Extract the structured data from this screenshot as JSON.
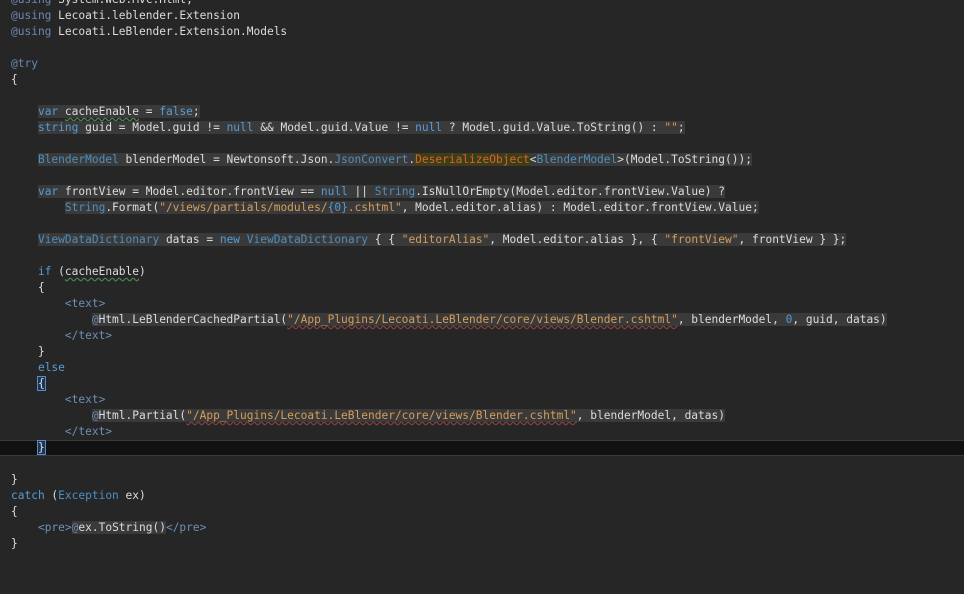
{
  "editor": {
    "lines": [
      {
        "n": 0,
        "segments": [
          {
            "t": "@using",
            "c": "at"
          },
          {
            "t": " System.Web.Mvc.Html;",
            "c": ""
          }
        ]
      },
      {
        "n": 1,
        "segments": [
          {
            "t": "@using",
            "c": "at"
          },
          {
            "t": " Lecoati.leblender.Extension",
            "c": ""
          }
        ]
      },
      {
        "n": 2,
        "segments": [
          {
            "t": "@using",
            "c": "at"
          },
          {
            "t": " Lecoati.LeBlender.Extension.Models",
            "c": ""
          }
        ]
      },
      {
        "n": 3,
        "segments": []
      },
      {
        "n": 4,
        "segments": [
          {
            "t": "@try",
            "c": "at"
          }
        ]
      },
      {
        "n": 5,
        "segments": [
          {
            "t": "{",
            "c": ""
          }
        ]
      },
      {
        "n": 6,
        "segments": []
      },
      {
        "n": 7,
        "segments": [
          {
            "t": "    ",
            "c": ""
          },
          {
            "t": "var",
            "c": "kw hl"
          },
          {
            "t": " ",
            "c": "hl"
          },
          {
            "t": "cacheEnable",
            "c": "hl ul"
          },
          {
            "t": " = ",
            "c": "hl"
          },
          {
            "t": "false",
            "c": "kw hl"
          },
          {
            "t": ";",
            "c": "hl"
          }
        ]
      },
      {
        "n": 8,
        "segments": [
          {
            "t": "    ",
            "c": ""
          },
          {
            "t": "string",
            "c": "kw hl"
          },
          {
            "t": " guid = Model.guid != ",
            "c": "hl"
          },
          {
            "t": "null",
            "c": "kw hl"
          },
          {
            "t": " && Model.guid.Value != ",
            "c": "hl"
          },
          {
            "t": "null",
            "c": "kw hl"
          },
          {
            "t": " ? Model.guid.Value.ToString() : ",
            "c": "hl"
          },
          {
            "t": "\"\"",
            "c": "st hl"
          },
          {
            "t": ";",
            "c": "hl"
          }
        ]
      },
      {
        "n": 9,
        "segments": []
      },
      {
        "n": 10,
        "segments": [
          {
            "t": "    ",
            "c": ""
          },
          {
            "t": "BlenderModel",
            "c": "ty hl"
          },
          {
            "t": " blenderModel = Newtonsoft.Json.",
            "c": "hl"
          },
          {
            "t": "JsonConvert",
            "c": "ty hl"
          },
          {
            "t": ".",
            "c": "hl"
          },
          {
            "t": "DeserializeObject",
            "c": "err"
          },
          {
            "t": "<",
            "c": "hl"
          },
          {
            "t": "BlenderModel",
            "c": "ty hl"
          },
          {
            "t": ">(Model.ToString());",
            "c": "hl"
          }
        ]
      },
      {
        "n": 11,
        "segments": []
      },
      {
        "n": 12,
        "segments": [
          {
            "t": "    ",
            "c": ""
          },
          {
            "t": "var",
            "c": "kw hl"
          },
          {
            "t": " frontView = Model.editor.frontView == ",
            "c": "hl"
          },
          {
            "t": "null",
            "c": "kw hl"
          },
          {
            "t": " || ",
            "c": "hl"
          },
          {
            "t": "String",
            "c": "ty hl"
          },
          {
            "t": ".IsNullOrEmpty(Model.editor.frontView.Value) ?",
            "c": "hl"
          }
        ]
      },
      {
        "n": 13,
        "segments": [
          {
            "t": "        ",
            "c": ""
          },
          {
            "t": "String",
            "c": "ty hl"
          },
          {
            "t": ".Format(",
            "c": "hl"
          },
          {
            "t": "\"/views/partials/modules/",
            "c": "st hl"
          },
          {
            "t": "{0}",
            "c": "kw hl"
          },
          {
            "t": ".cshtml\"",
            "c": "st hl"
          },
          {
            "t": ", Model.editor.alias) : Model.editor.frontView.Value;",
            "c": "hl"
          }
        ]
      },
      {
        "n": 14,
        "segments": []
      },
      {
        "n": 15,
        "segments": [
          {
            "t": "    ",
            "c": ""
          },
          {
            "t": "ViewDataDictionary",
            "c": "ty hl"
          },
          {
            "t": " datas = ",
            "c": "hl"
          },
          {
            "t": "new",
            "c": "kw hl"
          },
          {
            "t": " ",
            "c": "hl"
          },
          {
            "t": "ViewDataDictionary",
            "c": "ty hl"
          },
          {
            "t": " { { ",
            "c": "hl"
          },
          {
            "t": "\"editorAlias\"",
            "c": "st hl"
          },
          {
            "t": ", Model.editor.alias }, { ",
            "c": "hl"
          },
          {
            "t": "\"frontView\"",
            "c": "st hl"
          },
          {
            "t": ", frontView } };",
            "c": "hl"
          }
        ]
      },
      {
        "n": 16,
        "segments": []
      },
      {
        "n": 17,
        "segments": [
          {
            "t": "    ",
            "c": ""
          },
          {
            "t": "if",
            "c": "kw"
          },
          {
            "t": " (",
            "c": ""
          },
          {
            "t": "cacheEnable",
            "c": "ul"
          },
          {
            "t": ")",
            "c": ""
          }
        ]
      },
      {
        "n": 18,
        "segments": [
          {
            "t": "    {",
            "c": ""
          }
        ]
      },
      {
        "n": 19,
        "segments": [
          {
            "t": "        ",
            "c": ""
          },
          {
            "t": "<text>",
            "c": "hm"
          }
        ]
      },
      {
        "n": 20,
        "segments": [
          {
            "t": "            ",
            "c": ""
          },
          {
            "t": "@",
            "c": "at hl"
          },
          {
            "t": "Html.LeBlenderCachedPartial(",
            "c": "hl"
          },
          {
            "t": "\"/App_Plugins/Lecoati.LeBlender/core/views/Blender.cshtml\"",
            "c": "st hl ulr"
          },
          {
            "t": ", blenderModel, ",
            "c": "hl"
          },
          {
            "t": "0",
            "c": "kw hl"
          },
          {
            "t": ", guid, datas)",
            "c": "hl"
          }
        ]
      },
      {
        "n": 21,
        "segments": [
          {
            "t": "        ",
            "c": ""
          },
          {
            "t": "</text>",
            "c": "hm"
          }
        ]
      },
      {
        "n": 22,
        "segments": [
          {
            "t": "    }",
            "c": ""
          }
        ]
      },
      {
        "n": 23,
        "segments": [
          {
            "t": "    ",
            "c": ""
          },
          {
            "t": "else",
            "c": "kw"
          }
        ]
      },
      {
        "n": 24,
        "segments": [
          {
            "t": "    ",
            "c": ""
          },
          {
            "t": "{",
            "c": "brace-match"
          }
        ]
      },
      {
        "n": 25,
        "segments": [
          {
            "t": "        ",
            "c": ""
          },
          {
            "t": "<text>",
            "c": "hm"
          }
        ]
      },
      {
        "n": 26,
        "segments": [
          {
            "t": "            ",
            "c": ""
          },
          {
            "t": "@",
            "c": "at hl"
          },
          {
            "t": "Html.Partial(",
            "c": "hl"
          },
          {
            "t": "\"/App_Plugins/Lecoati.LeBlender/core/views/Blender.cshtml\"",
            "c": "st hl ulr"
          },
          {
            "t": ", blenderModel, datas)",
            "c": "hl"
          }
        ]
      },
      {
        "n": 27,
        "segments": [
          {
            "t": "        ",
            "c": ""
          },
          {
            "t": "</text>",
            "c": "hm"
          }
        ]
      },
      {
        "n": 28,
        "current": true,
        "segments": [
          {
            "t": "    ",
            "c": ""
          },
          {
            "t": "}",
            "c": "brace-match"
          },
          {
            "t": "",
            "c": "caret"
          }
        ]
      },
      {
        "n": 29,
        "segments": []
      },
      {
        "n": 30,
        "segments": [
          {
            "t": "}",
            "c": ""
          }
        ]
      },
      {
        "n": 31,
        "segments": [
          {
            "t": "catch",
            "c": "kw"
          },
          {
            "t": " (",
            "c": ""
          },
          {
            "t": "Exception",
            "c": "ty"
          },
          {
            "t": " ex)",
            "c": ""
          }
        ]
      },
      {
        "n": 32,
        "segments": [
          {
            "t": "{",
            "c": ""
          }
        ]
      },
      {
        "n": 33,
        "segments": [
          {
            "t": "    ",
            "c": ""
          },
          {
            "t": "<pre>",
            "c": "hm"
          },
          {
            "t": "@",
            "c": "at hl"
          },
          {
            "t": "ex.ToString()",
            "c": "hl"
          },
          {
            "t": "</pre>",
            "c": "hm"
          }
        ]
      },
      {
        "n": 34,
        "segments": [
          {
            "t": "}",
            "c": ""
          }
        ]
      }
    ]
  }
}
